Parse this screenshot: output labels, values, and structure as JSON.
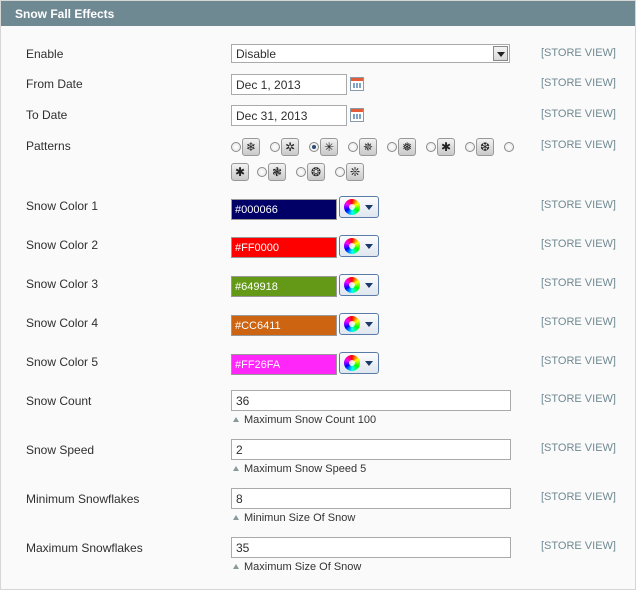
{
  "section": {
    "title": "Snow Fall Effects"
  },
  "scope_label": "[STORE VIEW]",
  "enable": {
    "label": "Enable",
    "value": "Disable"
  },
  "from_date": {
    "label": "From Date",
    "value": "Dec 1, 2013"
  },
  "to_date": {
    "label": "To Date",
    "value": "Dec 31, 2013"
  },
  "patterns": {
    "label": "Patterns",
    "selected_index": 2,
    "glyphs": [
      "❄",
      "✲",
      "✳",
      "✵",
      "❅",
      "✱",
      "❆",
      "",
      "✱",
      "❃",
      "❂",
      "❊"
    ]
  },
  "colors": [
    {
      "label": "Snow Color 1",
      "value": "#000066",
      "hex": "#000066"
    },
    {
      "label": "Snow Color 2",
      "value": "#FF0000",
      "hex": "#FF0000"
    },
    {
      "label": "Snow Color 3",
      "value": "#649918",
      "hex": "#649918"
    },
    {
      "label": "Snow Color 4",
      "value": "#CC6411",
      "hex": "#CC6411"
    },
    {
      "label": "Snow Color 5",
      "value": "#FF26FA",
      "hex": "#FF26FA"
    }
  ],
  "snow_count": {
    "label": "Snow Count",
    "value": "36",
    "note": "Maximum Snow Count 100"
  },
  "snow_speed": {
    "label": "Snow Speed",
    "value": "2",
    "note": "Maximum Snow Speed 5"
  },
  "min_flakes": {
    "label": "Minimum Snowflakes",
    "value": "8",
    "note": "Minimun Size Of Snow"
  },
  "max_flakes": {
    "label": "Maximum Snowflakes",
    "value": "35",
    "note": "Maximum Size Of Snow"
  }
}
